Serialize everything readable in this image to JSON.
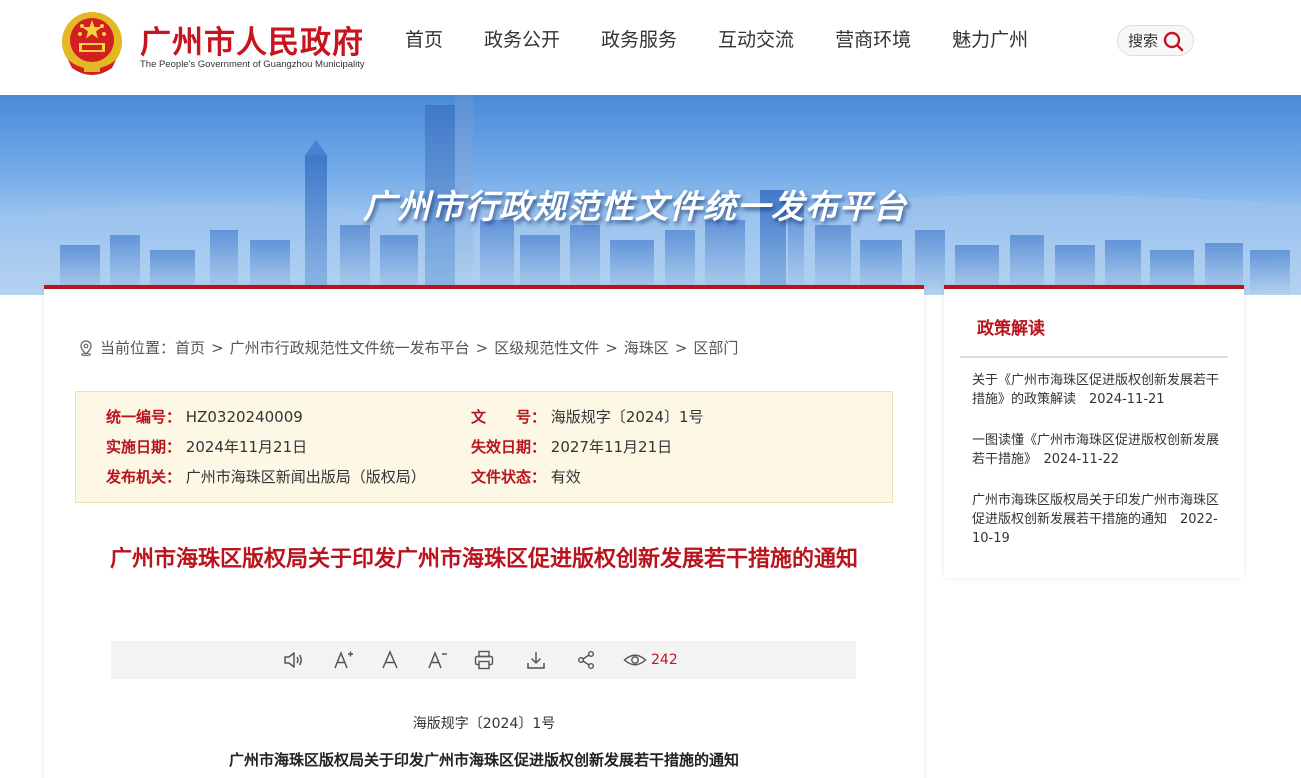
{
  "header": {
    "site_title": "广州市人民政府",
    "site_subtitle": "The People's Government of Guangzhou Municipality",
    "nav": [
      "首页",
      "政务公开",
      "政务服务",
      "互动交流",
      "营商环境",
      "魅力广州"
    ],
    "search_label": "搜索"
  },
  "banner": {
    "title": "广州市行政规范性文件统一发布平台"
  },
  "breadcrumb": {
    "prefix": "当前位置：",
    "items": [
      "首页",
      "广州市行政规范性文件统一发布平台",
      "区级规范性文件",
      "海珠区",
      "区部门"
    ],
    "separator": ">"
  },
  "info": {
    "serial_label": "统一编号：",
    "serial_value": "HZ0320240009",
    "docno_label": "文　　号：",
    "docno_value": "海版规字〔2024〕1号",
    "effective_label": "实施日期：",
    "effective_value": "2024年11月21日",
    "expiry_label": "失效日期：",
    "expiry_value": "2027年11月21日",
    "issuer_label": "发布机关：",
    "issuer_value": "广州市海珠区新闻出版局（版权局）",
    "status_label": "文件状态：",
    "status_value": "有效"
  },
  "document": {
    "title": "广州市海珠区版权局关于印发广州市海珠区促进版权创新发展若干措施的通知",
    "doc_number": "海版规字〔2024〕1号",
    "subtitle": "广州市海珠区版权局关于印发广州市海珠区促进版权创新发展若干措施的通知",
    "view_count": "242"
  },
  "toolbar": {
    "icons": [
      "speaker-icon",
      "font-increase-icon",
      "font-normal-icon",
      "font-decrease-icon",
      "print-icon",
      "download-icon",
      "share-icon",
      "eye-icon"
    ]
  },
  "sidebar": {
    "title": "政策解读",
    "items": [
      {
        "text": "关于《广州市海珠区促进版权创新发展若干措施》的政策解读　2024-11-21"
      },
      {
        "text": "一图读懂《广州市海珠区促进版权创新发展若干措施》　2024-11-22"
      },
      {
        "text": "广州市海珠区版权局关于印发广州市海珠区促进版权创新发展若干措施的通知　2022-10-19"
      }
    ]
  },
  "colors": {
    "brand_red": "#c8141e",
    "info_bg": "#fdf7e6"
  }
}
